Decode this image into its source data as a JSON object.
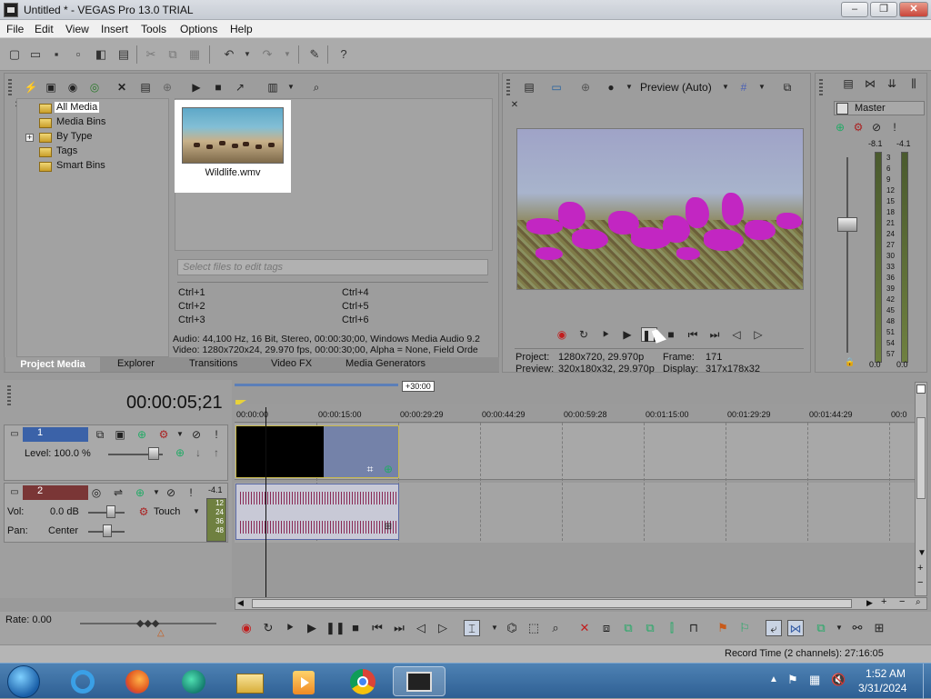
{
  "window": {
    "title": "Untitled * - VEGAS Pro 13.0 TRIAL"
  },
  "menu": [
    "File",
    "Edit",
    "View",
    "Insert",
    "Tools",
    "Options",
    "Help"
  ],
  "media_tree": [
    "All Media",
    "Media Bins",
    "By Type",
    "Tags",
    "Smart Bins"
  ],
  "media_file": "Wildlife.wmv",
  "tags_placeholder": "Select files to edit tags",
  "shortcuts": [
    "Ctrl+1",
    "Ctrl+2",
    "Ctrl+3",
    "Ctrl+4",
    "Ctrl+5",
    "Ctrl+6"
  ],
  "media_info": {
    "audio": "Audio: 44,100 Hz, 16 Bit, Stereo, 00:00:30;00, Windows Media Audio 9.2",
    "video": "Video: 1280x720x24, 29.970 fps, 00:00:30;00, Alpha = None, Field Orde"
  },
  "tabs": [
    "Project Media",
    "Explorer",
    "Transitions",
    "Video FX",
    "Media Generators"
  ],
  "preview": {
    "mode": "Preview (Auto)",
    "project_label": "Project:",
    "project": "1280x720, 29.970p",
    "preview_label": "Preview:",
    "preview": "320x180x32, 29.970p",
    "frame_label": "Frame:",
    "frame": "171",
    "display_label": "Display:",
    "display": "317x178x32"
  },
  "master": {
    "title": "Master",
    "peak_l": "-8.1",
    "peak_r": "-4.1",
    "ticks": [
      "3",
      "6",
      "9",
      "12",
      "15",
      "18",
      "21",
      "24",
      "27",
      "30",
      "33",
      "36",
      "39",
      "42",
      "45",
      "48",
      "51",
      "54",
      "57"
    ],
    "bottom_l": "0.0",
    "bottom_r": "0.0"
  },
  "timeline": {
    "timecode": "00:00:05;21",
    "region": "+30:00",
    "ruler": [
      "00:00:00",
      "00:00:15:00",
      "00:00:29:29",
      "00:00:44:29",
      "00:00:59:28",
      "00:01:15:00",
      "00:01:29:29",
      "00:01:44:29",
      "00:0"
    ],
    "video_track": {
      "num": "1",
      "level": "Level: 100.0 %"
    },
    "audio_track": {
      "num": "2",
      "peak": "-4.1",
      "vol_label": "Vol:",
      "vol": "0.0 dB",
      "pan_label": "Pan:",
      "pan": "Center",
      "mode": "Touch",
      "meter": [
        "12",
        "24",
        "36",
        "48"
      ]
    }
  },
  "rate": "Rate: 0.00",
  "status": "Record Time (2 channels): 27:16:05",
  "clock": {
    "time": "1:52 AM",
    "date": "3/31/2024"
  },
  "colors": {
    "accent": "#3b62a8",
    "clip_border": "#c9b94a",
    "audio_wave": "#8a2a55",
    "bird": "#c226c2"
  }
}
